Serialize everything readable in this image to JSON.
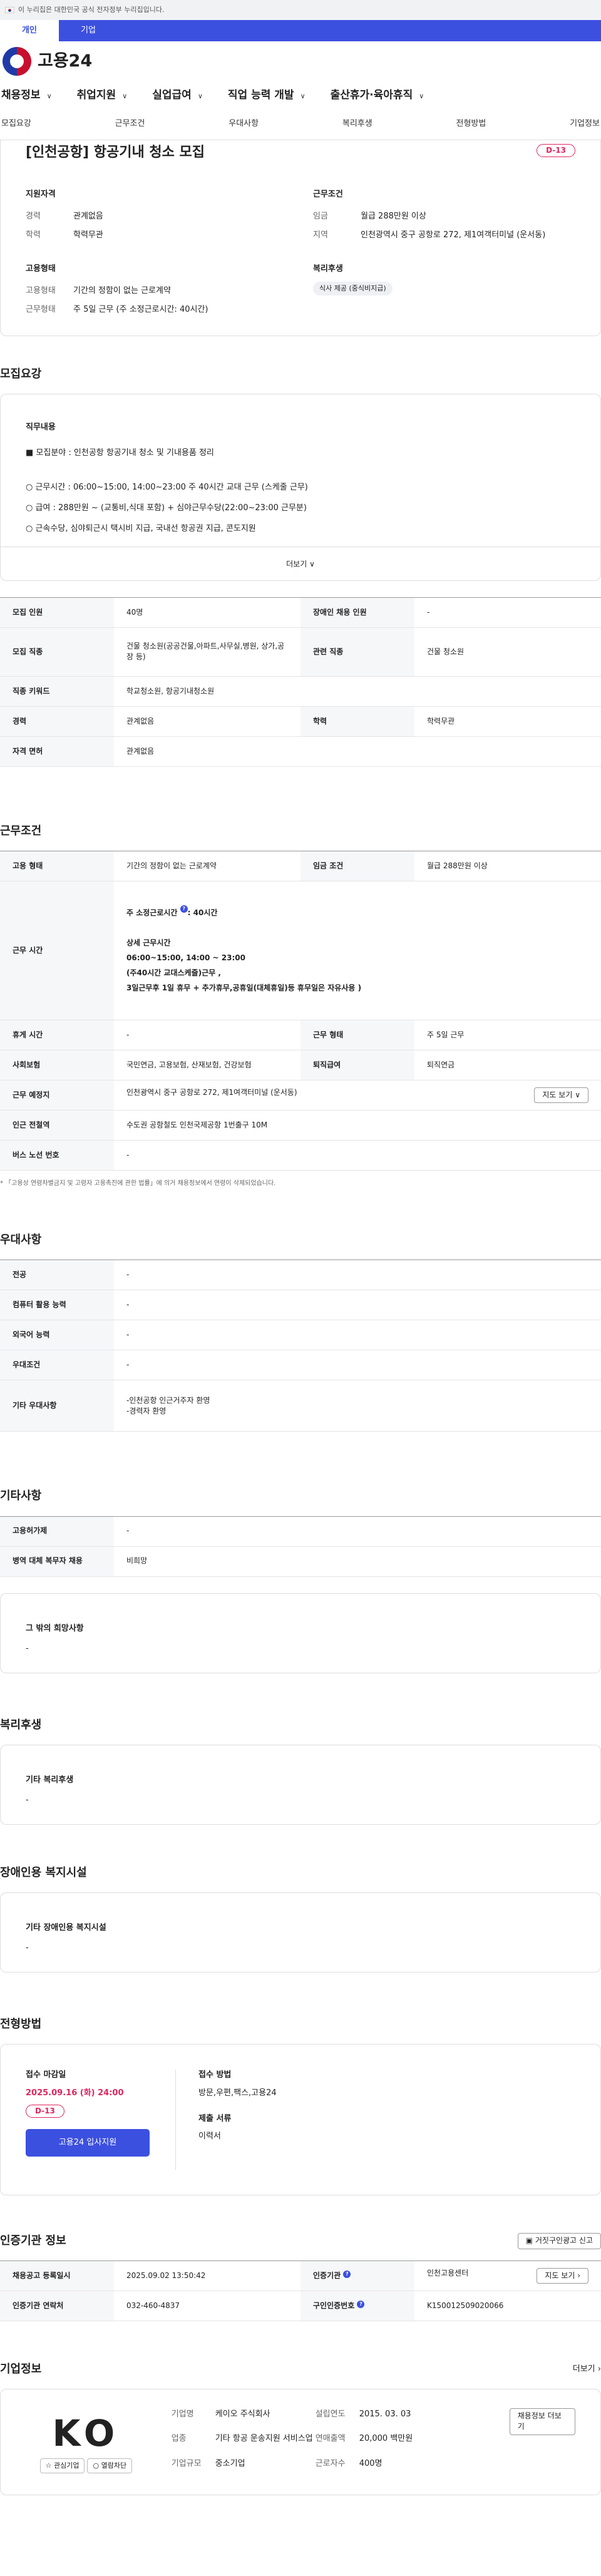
{
  "gov_banner": "이 누리집은 대한민국 공식 전자정부 누리집입니다.",
  "user_tabs": [
    "개인",
    "기업"
  ],
  "logo": "고용24",
  "gnb": [
    "채용정보",
    "취업지원",
    "실업급여",
    "직업 능력 개발",
    "출산휴가·육아휴직"
  ],
  "anchors": [
    "모집요강",
    "근무조건",
    "우대사항",
    "복리후생",
    "전형방법",
    "기업정보"
  ],
  "title": "[인천공항] 항공기내 청소 모집",
  "dday": "D-13",
  "summary": {
    "qual_h": "지원자격",
    "career_k": "경력",
    "career_v": "관계없음",
    "edu_k": "학력",
    "edu_v": "학력무관",
    "cond_h": "근무조건",
    "wage_k": "임금",
    "wage_v": "월급 288만원 이상",
    "area_k": "지역",
    "area_v": "인천광역시 중구 공항로 272, 제1여객터미널 (운서동)",
    "emp_h": "고용형태",
    "emptype_k": "고용형태",
    "emptype_v": "기간의 정함이 없는 근로계약",
    "work_k": "근무형태",
    "work_v": "주 5일 근무 (주 소정근로시간: 40시간)",
    "wel_h": "복리후생",
    "wel_chip": "식사 제공 (중식비지급)"
  },
  "recruit": {
    "h": "모집요강",
    "duty_h": "직무내용",
    "duty": [
      "■ 모집분야 : 인천공항 항공기내 청소 및 기내용품 정리",
      "○ 근무시간 :  06:00~15:00, 14:00~23:00   주 40시간 교대 근무 (스케줄 근무)",
      "○ 급여 : 288만원 ~ (교통비,식대 포함) +   심야근무수당(22:00~23:00 근무분)",
      "○ 근속수당, 심야퇴근시 택시비 지급, 국내선 항공권 지급,  콘도지원"
    ],
    "more": "더보기",
    "rows": [
      [
        "모집 인원",
        "40명",
        "장애인 채용 인원",
        "-"
      ],
      [
        "모집 직종",
        "건물 청소원(공공건물,아파트,사무실,병원, 상가,공장 등)",
        "관련 직종",
        "건물 청소원"
      ],
      [
        "직종 키워드",
        "학교청소원, 항공기내청소원",
        "",
        ""
      ],
      [
        "경력",
        "관계없음",
        "학력",
        "학력무관"
      ],
      [
        "자격 면허",
        "관계없음",
        "",
        ""
      ]
    ]
  },
  "work": {
    "h": "근무조건",
    "emp_k": "고용 형태",
    "emp_v": "기간의 정함이 없는 근로계약",
    "wage_k": "임금 조건",
    "wage_v": "월급 288만원 이상",
    "time_k": "근무 시간",
    "time_lines": [
      "주 소정근로시간",
      "40시간",
      "상세 근무시간",
      "06:00~15:00,  14:00 ~ 23:00",
      "(주40시간  교대스케줄)근무 ,",
      "  3일근무후 1일 휴무 +  추가휴무,공휴일(대체휴일)등  휴무일은 자유사용 )"
    ],
    "rest_k": "휴게 시간",
    "rest_v": "-",
    "form_k": "근무 형태",
    "form_v": "주 5일 근무",
    "ins_k": "사회보험",
    "ins_v": "국민연금, 고용보험, 산재보험, 건강보험",
    "ret_k": "퇴직급여",
    "ret_v": "퇴직연금",
    "place_k": "근무 예정지",
    "place_v": "인천광역시 중구 공항로 272, 제1여객터미널 (운서동)",
    "map_btn": "지도 보기",
    "sub_k": "인근 전철역",
    "sub_v": "수도권 공항철도 인천국제공항 1번출구 10M",
    "bus_k": "버스 노선 번호",
    "bus_v": "-",
    "note": "* 「고용상 연령차별금지 및 고령자 고용촉진에 관한 법률」에 의거 채용정보에서 연령이 삭제되었습니다."
  },
  "pref": {
    "h": "우대사항",
    "rows": [
      [
        "전공",
        "-"
      ],
      [
        "컴퓨터 활용 능력",
        "-"
      ],
      [
        "외국어 능력",
        "-"
      ],
      [
        "우대조건",
        "-"
      ],
      [
        "기타 우대사항",
        "-인천공항 인근거주자 환영\n-경력자 환영"
      ]
    ]
  },
  "etc": {
    "h": "기타사항",
    "rows": [
      [
        "고용허가제",
        "-"
      ],
      [
        "병역 대체 복무자 채용",
        "비희망"
      ]
    ],
    "hope_h": "그 밖의 희망사항",
    "hope_v": "-"
  },
  "welfare": {
    "h": "복리후생",
    "sub": "기타 복리후생",
    "v": "-"
  },
  "disab": {
    "h": "장애인용 복지시설",
    "sub": "기타 장애인용 복지시설",
    "v": "-"
  },
  "screen": {
    "h": "전형방법",
    "deadline_h": "접수 마감일",
    "deadline": "2025.09.16 (화) 24:00",
    "dday": "D-13",
    "apply_btn": "고용24 입사지원",
    "method_h": "접수 방법",
    "method": "방문,우편,팩스,고용24",
    "docs_h": "제출 서류",
    "docs": "이력서"
  },
  "cert": {
    "h": "인증기관 정보",
    "report_btn": "거짓구인광고 신고",
    "rows": [
      [
        "채용공고 등록일시",
        "2025.09.02 13:50:42",
        "인증기관",
        "인천고용센터"
      ],
      [
        "인증기관 연락처",
        "032-460-4837",
        "구인인증번호",
        "K150012509020066"
      ]
    ],
    "map_btn": "지도 보기"
  },
  "company": {
    "h": "기업정보",
    "more": "더보기",
    "logo": "KO",
    "fav": "관심기업",
    "block": "열람차단",
    "rows": [
      [
        "기업명",
        "케이오 주식회사",
        "설립연도",
        "2015. 03. 03"
      ],
      [
        "업종",
        "기타 항공 운송지원 서비스업",
        "연매출액",
        "20,000 백만원"
      ],
      [
        "기업규모",
        "중소기업",
        "근로자수",
        "400명"
      ]
    ],
    "recruit_btn": "채용정보 더보기"
  }
}
